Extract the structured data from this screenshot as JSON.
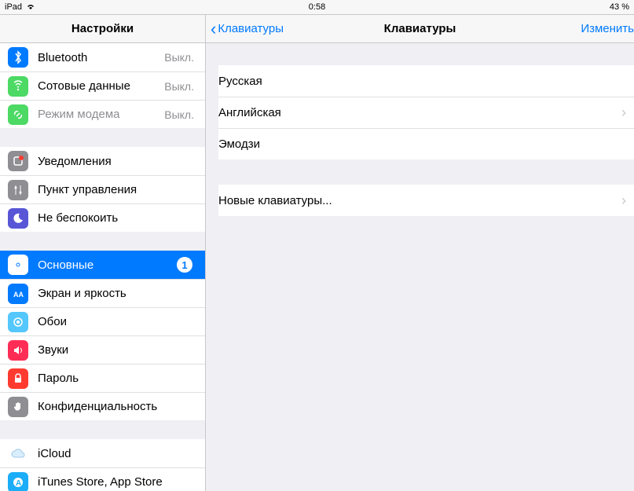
{
  "status": {
    "device": "iPad",
    "time": "0:58",
    "battery": "43 %"
  },
  "sidebar": {
    "title": "Настройки",
    "groups": [
      [
        {
          "id": "bluetooth",
          "label": "Bluetooth",
          "value": "Выкл.",
          "color": "#007aff",
          "icon": "bluetooth"
        },
        {
          "id": "cellular",
          "label": "Сотовые данные",
          "value": "Выкл.",
          "color": "#4cd964",
          "icon": "cellular"
        },
        {
          "id": "hotspot",
          "label": "Режим модема",
          "value": "Выкл.",
          "color": "#4cd964",
          "icon": "link",
          "disabled": true
        }
      ],
      [
        {
          "id": "notifications",
          "label": "Уведомления",
          "color": "#8e8e93",
          "icon": "notify"
        },
        {
          "id": "control-center",
          "label": "Пункт управления",
          "color": "#8e8e93",
          "icon": "control"
        },
        {
          "id": "dnd",
          "label": "Не беспокоить",
          "color": "#5856d6",
          "icon": "moon"
        }
      ],
      [
        {
          "id": "general",
          "label": "Основные",
          "color": "#8e8e93",
          "icon": "gear",
          "badge": "1",
          "selected": true
        },
        {
          "id": "display",
          "label": "Экран и яркость",
          "color": "#007aff",
          "icon": "display"
        },
        {
          "id": "wallpaper",
          "label": "Обои",
          "color": "#54c7fc",
          "icon": "wallpaper"
        },
        {
          "id": "sounds",
          "label": "Звуки",
          "color": "#ff2d55",
          "icon": "sound"
        },
        {
          "id": "passcode",
          "label": "Пароль",
          "color": "#ff3b30",
          "icon": "lock"
        },
        {
          "id": "privacy",
          "label": "Конфиденциальность",
          "color": "#8e8e93",
          "icon": "hand"
        }
      ],
      [
        {
          "id": "icloud",
          "label": "iCloud",
          "color": "#ffffff",
          "icon": "cloud"
        },
        {
          "id": "appstore",
          "label": "iTunes Store, App Store",
          "color": "#1badf8",
          "icon": "appstore"
        }
      ]
    ]
  },
  "detail": {
    "back_label": "Клавиатуры",
    "title": "Клавиатуры",
    "edit_label": "Изменить",
    "groups": [
      [
        {
          "label": "Русская",
          "chevron": false
        },
        {
          "label": "Английская",
          "chevron": true
        },
        {
          "label": "Эмодзи",
          "chevron": false
        }
      ],
      [
        {
          "label": "Новые клавиатуры...",
          "chevron": true
        }
      ]
    ]
  }
}
